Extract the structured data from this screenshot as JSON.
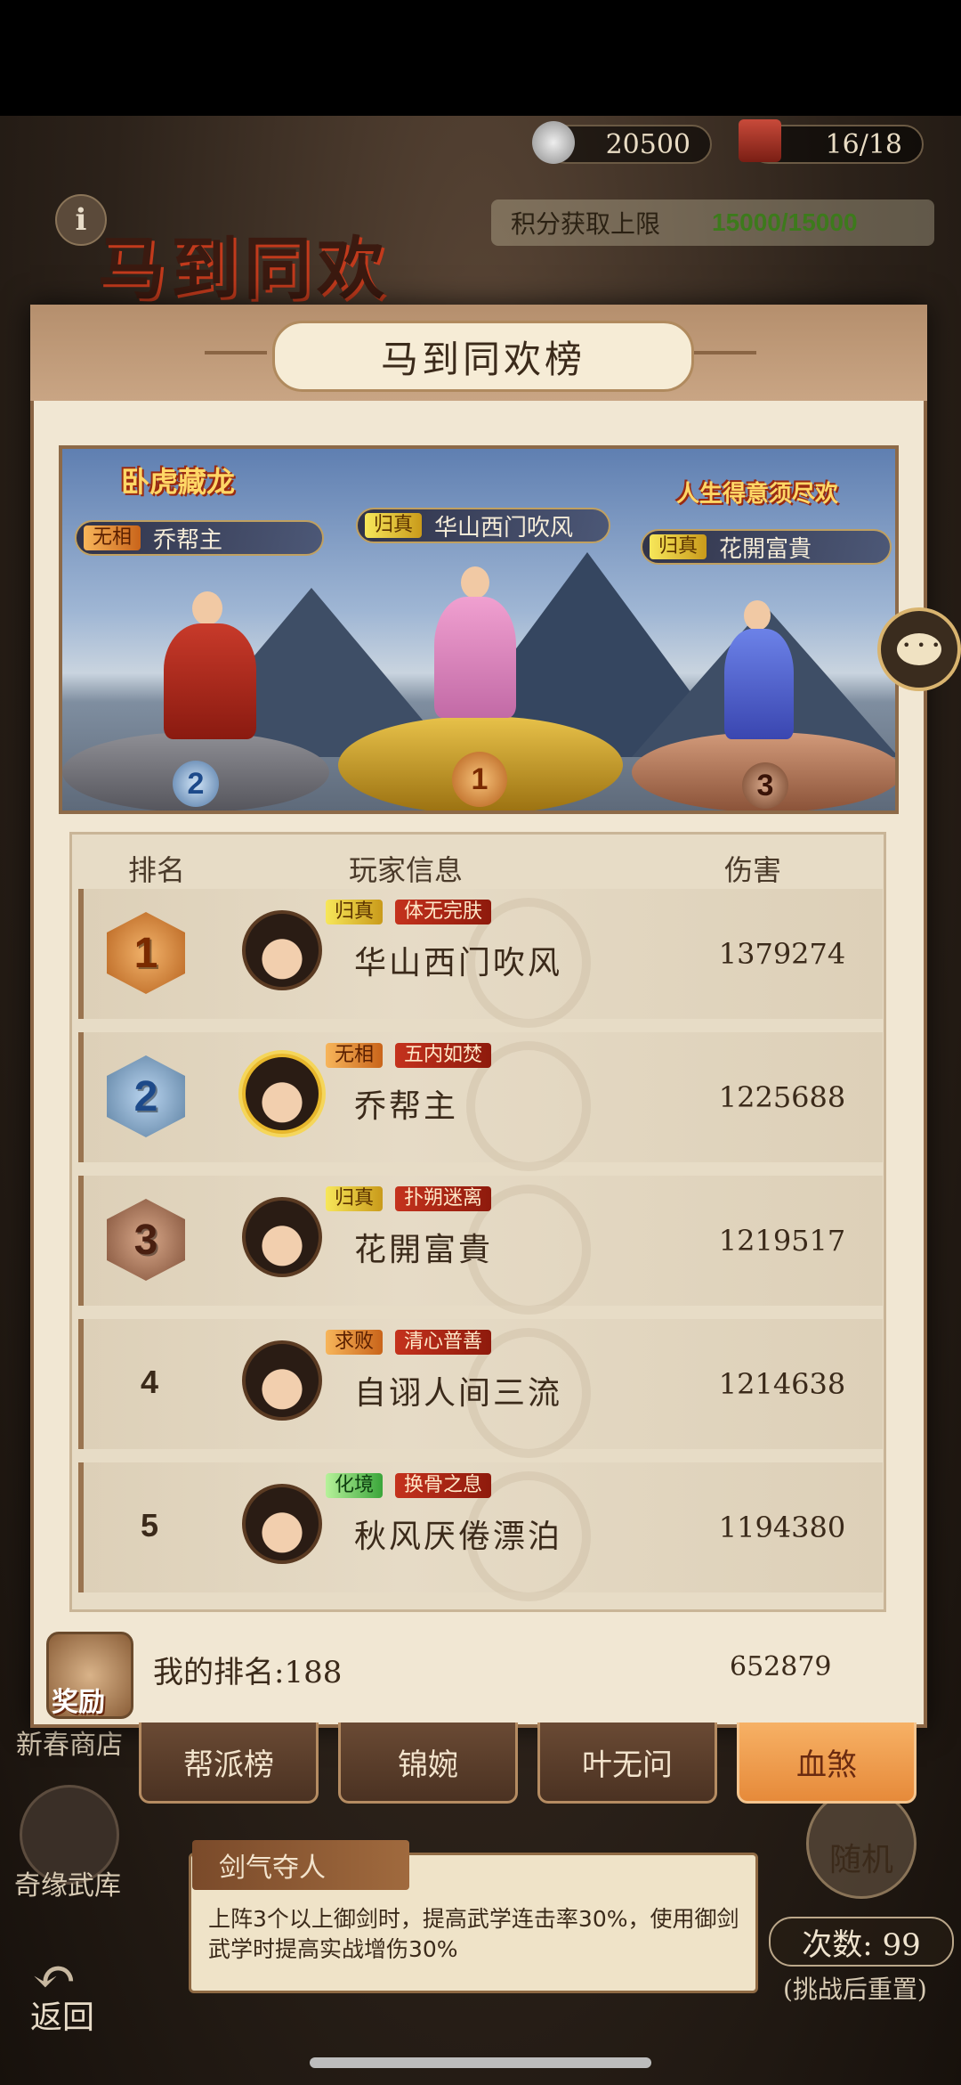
{
  "resources": {
    "currency_value": "20500",
    "tickets_value": "16/18",
    "currency_icon": "jade-coin-icon",
    "tickets_icon": "token-book-icon"
  },
  "event": {
    "logo_text": "马到同欢",
    "score_cap_label": "积分获取上限",
    "score_cap_value": "15000/15000"
  },
  "modal": {
    "title": "马到同欢榜"
  },
  "podium": [
    {
      "rank": "1",
      "realm": "归真",
      "name": "华山西门吹风",
      "title_art": ""
    },
    {
      "rank": "2",
      "realm": "无相",
      "name": "乔帮主",
      "title_art": "卧虎藏龙"
    },
    {
      "rank": "3",
      "realm": "归真",
      "name": "花開富貴",
      "title_art": "人生得意须尽欢"
    }
  ],
  "table": {
    "headers": {
      "rank": "排名",
      "player": "玩家信息",
      "damage": "伤害"
    },
    "rows": [
      {
        "rank": "1",
        "realm": "归真",
        "title": "体无完肤",
        "name": "华山西门吹风",
        "damage": "1379274"
      },
      {
        "rank": "2",
        "realm": "无相",
        "title": "五内如焚",
        "name": "乔帮主",
        "damage": "1225688"
      },
      {
        "rank": "3",
        "realm": "归真",
        "title": "扑朔迷离",
        "name": "花開富貴",
        "damage": "1219517"
      },
      {
        "rank": "4",
        "realm": "求败",
        "title": "清心普善",
        "name": "自诩人间三流",
        "damage": "1214638"
      },
      {
        "rank": "5",
        "realm": "化境",
        "title": "换骨之息",
        "name": "秋风厌倦漂泊",
        "damage": "1194380"
      }
    ]
  },
  "my_rank": {
    "reward_label": "奖励",
    "rank_text": "我的排名:188",
    "score": "652879"
  },
  "tabs": [
    {
      "label": "帮派榜",
      "active": false
    },
    {
      "label": "锦婉",
      "active": false
    },
    {
      "label": "叶无问",
      "active": false
    },
    {
      "label": "血煞",
      "active": true
    }
  ],
  "background_ui": {
    "shop_label": "新春商店",
    "wuku_label": "奇缘武库",
    "back_label": "返回",
    "random_label": "随机",
    "skill_name": "剑气夺人",
    "skill_desc": "上阵3个以上御剑时，提高武学连击率30%，使用御剑武学时提高实战增伤30%",
    "tries_text": "次数: 99",
    "tries_note": "(挑战后重置)"
  },
  "colors": {
    "accent_active_tab": "#e68a3a",
    "score_cap_value": "#3d7a1c",
    "modal_bg": "#f1e7d3"
  }
}
